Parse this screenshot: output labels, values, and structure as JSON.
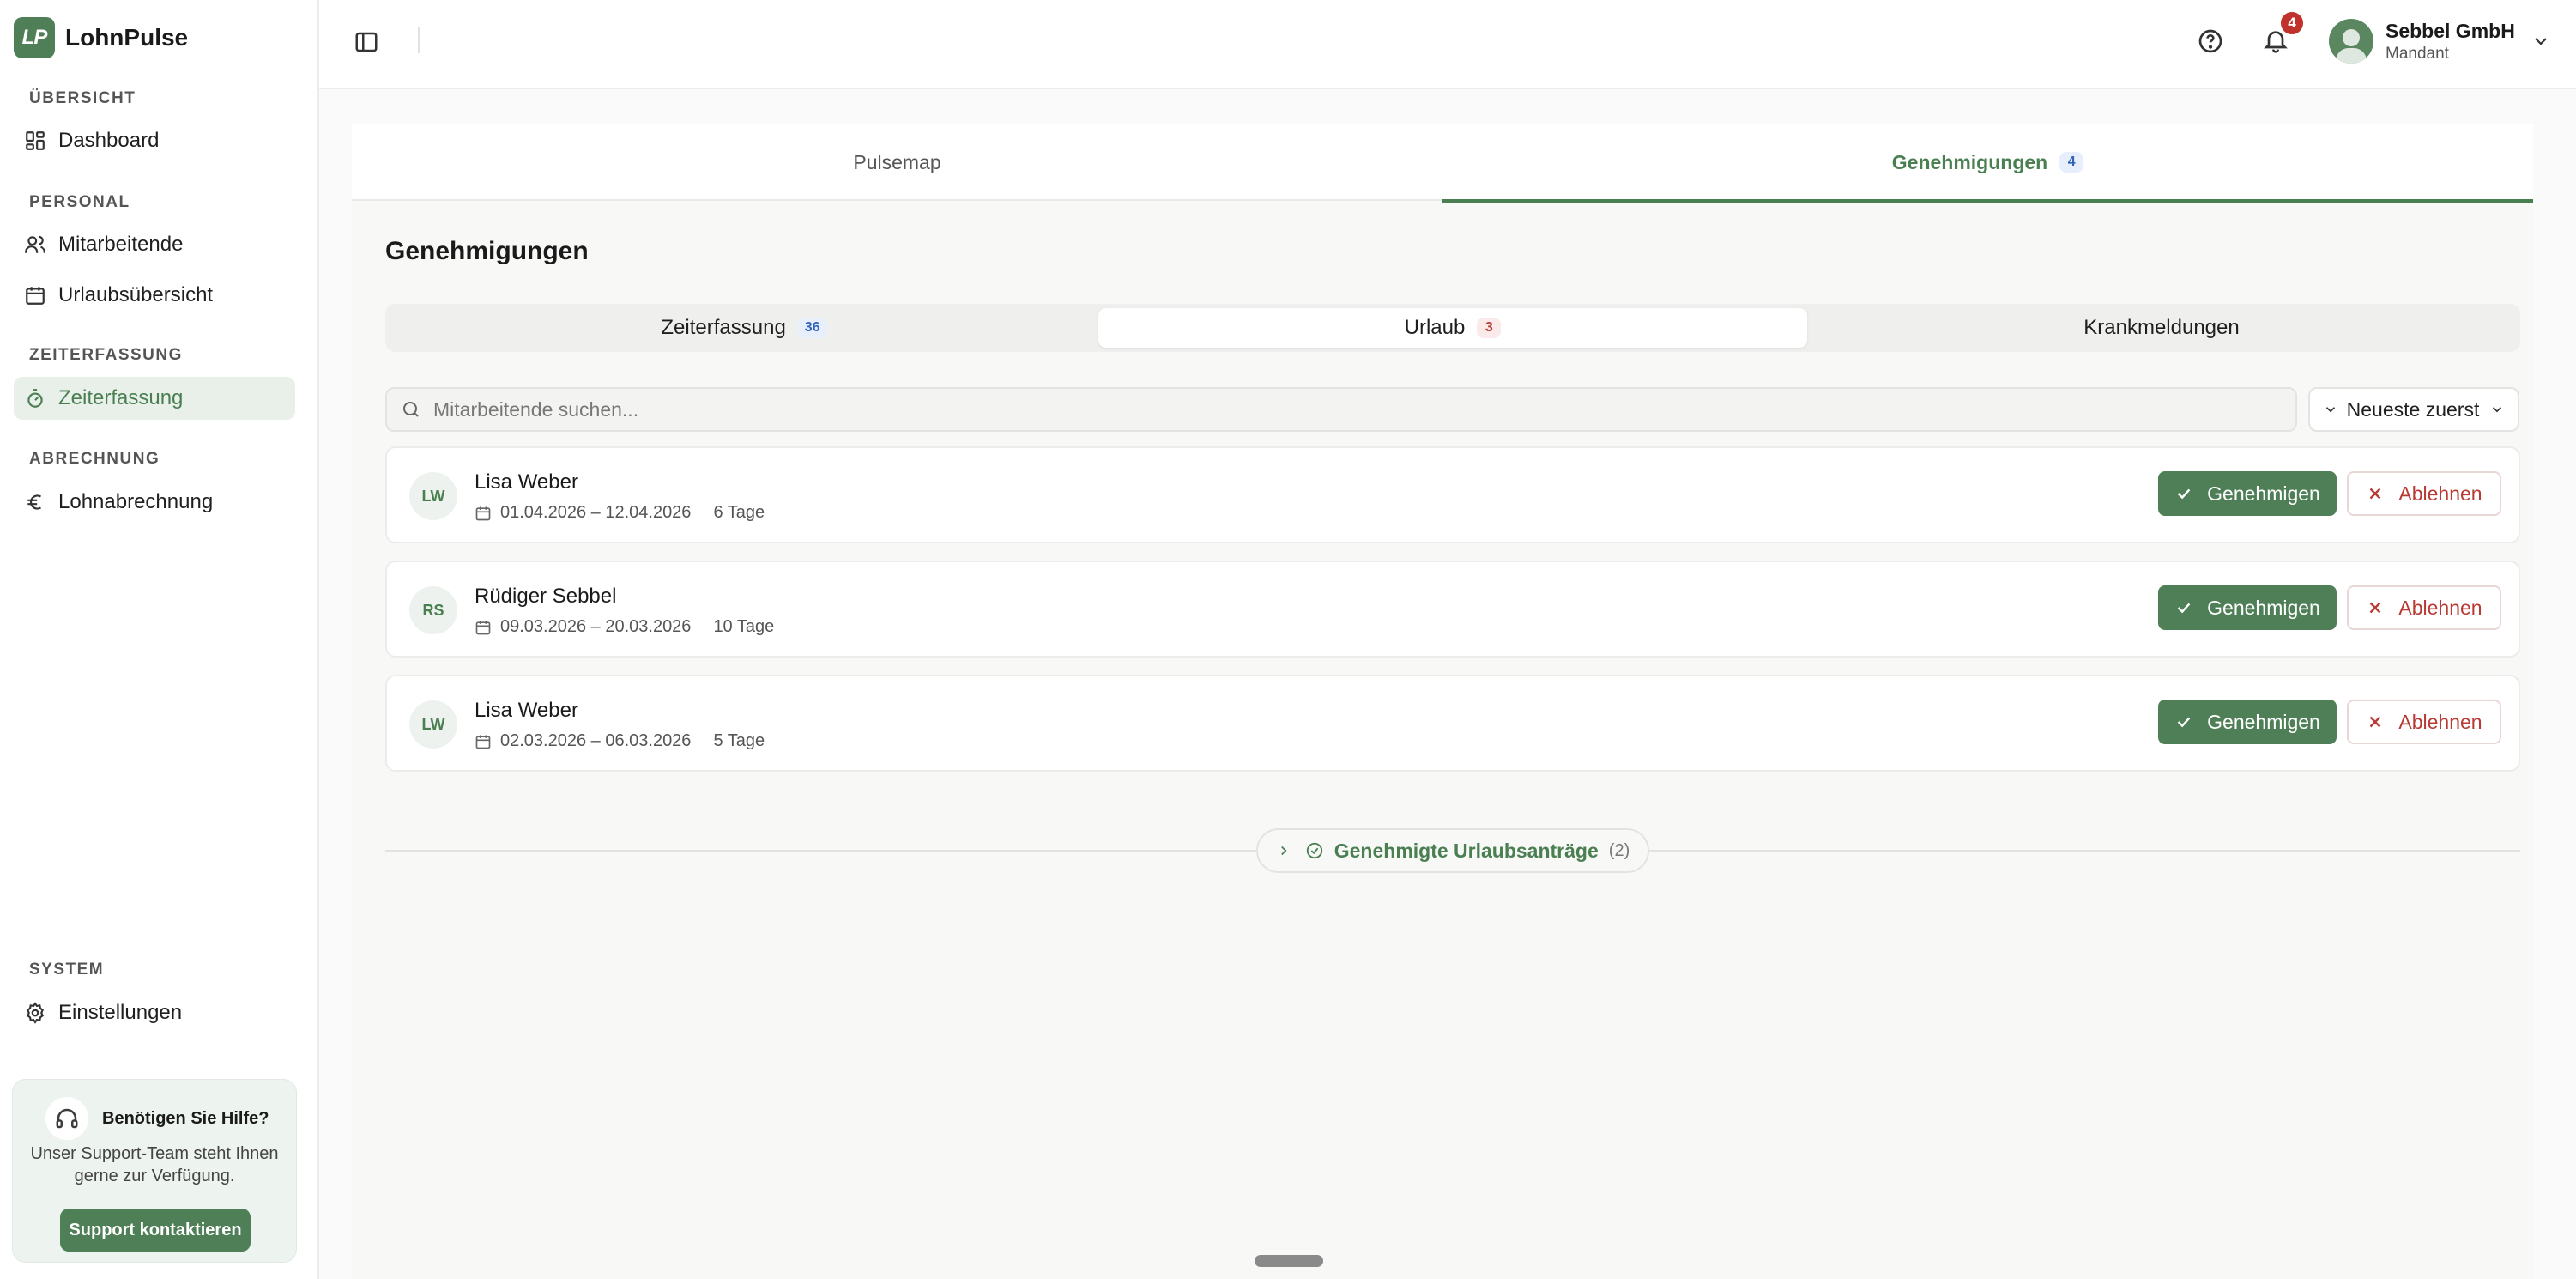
{
  "app": {
    "logo_text": "LP",
    "name": "LohnPulse"
  },
  "sidebar": {
    "sections": [
      {
        "label": "ÜBERSICHT"
      },
      {
        "label": "PERSONAL"
      },
      {
        "label": "ZEITERFASSUNG"
      },
      {
        "label": "ABRECHNUNG"
      },
      {
        "label": "SYSTEM"
      }
    ],
    "items": [
      {
        "label": "Dashboard",
        "icon": "dashboard-icon"
      },
      {
        "label": "Mitarbeitende",
        "icon": "users-icon"
      },
      {
        "label": "Urlaubsübersicht",
        "icon": "calendar-icon"
      },
      {
        "label": "Zeiterfassung",
        "icon": "stopwatch-icon",
        "active": true
      },
      {
        "label": "Lohnabrechnung",
        "icon": "euro-icon"
      },
      {
        "label": "Einstellungen",
        "icon": "gear-icon"
      }
    ],
    "help": {
      "title": "Benötigen Sie Hilfe?",
      "text": "Unser Support-Team steht Ihnen gerne zur Verfügung.",
      "button": "Support kontaktieren"
    }
  },
  "header": {
    "notification_count": "4",
    "account_name": "Sebbel GmbH",
    "account_role": "Mandant"
  },
  "top_tabs": [
    {
      "label": "Pulsemap",
      "badge": ""
    },
    {
      "label": "Genehmigungen",
      "badge": "4",
      "active": true
    }
  ],
  "main": {
    "title": "Genehmigungen",
    "sub_tabs": [
      {
        "label": "Zeiterfassung",
        "badge": "36"
      },
      {
        "label": "Urlaub",
        "badge": "3",
        "active": true
      },
      {
        "label": "Krankmeldungen",
        "badge": ""
      }
    ],
    "search_placeholder": "Mitarbeitende suchen...",
    "sort_label": "Neueste zuerst",
    "requests": [
      {
        "initials": "LW",
        "name": "Lisa Weber",
        "dates": "01.04.2026 – 12.04.2026",
        "days": "6 Tage"
      },
      {
        "initials": "RS",
        "name": "Rüdiger Sebbel",
        "dates": "09.03.2026 – 20.03.2026",
        "days": "10 Tage"
      },
      {
        "initials": "LW",
        "name": "Lisa Weber",
        "dates": "02.03.2026 – 06.03.2026",
        "days": "5 Tage"
      }
    ],
    "approve_label": "Genehmigen",
    "reject_label": "Ablehnen",
    "approved_label": "Genehmigte Urlaubsanträge",
    "approved_count": "(2)"
  },
  "colors": {
    "brand": "#4f7f57",
    "danger": "#b83a34",
    "badge_blue": "#2f64b8"
  }
}
